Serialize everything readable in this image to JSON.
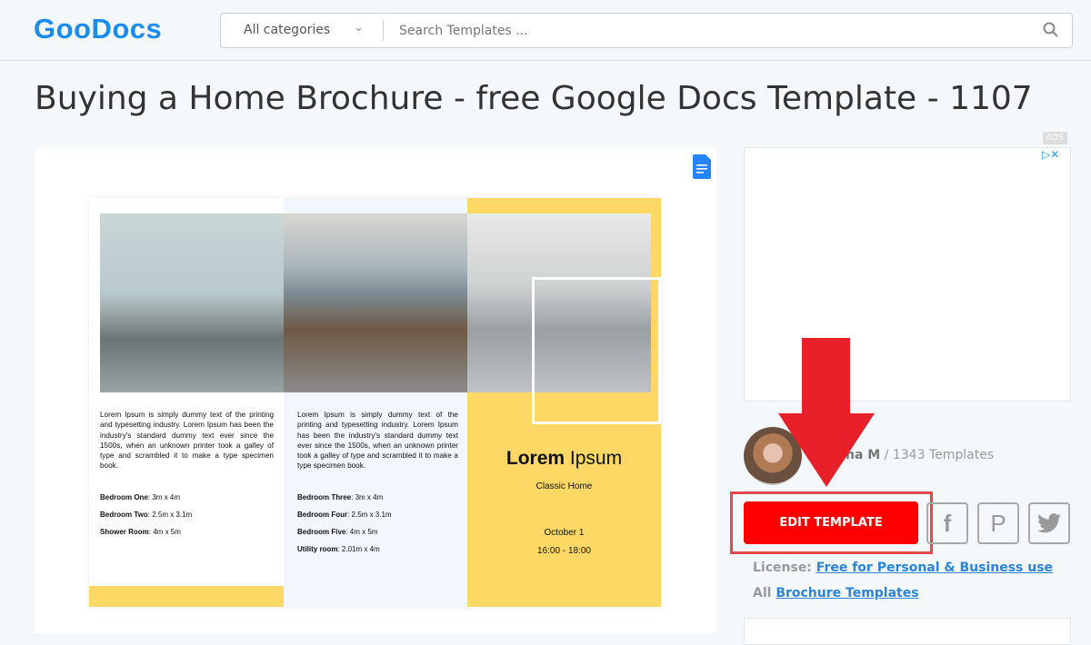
{
  "header": {
    "logo": "GooDocs",
    "category_select": "All categories",
    "search_placeholder": "Search Templates ..."
  },
  "page_title": "Buying a Home Brochure - free Google Docs Template - 1107",
  "brochure": {
    "lorem_left": "Lorem Ipsum is simply dummy text of the printing and typesetting industry. Lorem Ipsum has been the industry's standard dummy text ever since the 1500s, when an unknown printer took a galley of type and scrambled it to make a type specimen book.",
    "lorem_middle": "Lorem Ipsum is simply dummy text of the printing and typesetting industry. Lorem Ipsum has been the industry's standard dummy text ever since the 1500s, when an unknown printer took a galley of type and scrambled it to make a type specimen book.",
    "specs_left": [
      {
        "k": "Bedroom One",
        "v": ": 3m x 4m"
      },
      {
        "k": "Bedroom Two",
        "v": ": 2.5m x 3.1m"
      },
      {
        "k": "Shower Room",
        "v": ": 4m x 5m"
      }
    ],
    "specs_middle": [
      {
        "k": "Bedroom Three",
        "v": ": 3m x 4m"
      },
      {
        "k": "Bedroom Four",
        "v": ": 2.5m x 3.1m"
      },
      {
        "k": "Bedroom Five",
        "v": ": 4m x 5m"
      },
      {
        "k": "Utility room",
        "v": ": 2.01m x 4m"
      }
    ],
    "heading_bold": "Lorem",
    "heading_rest": " Ipsum",
    "subtitle": "Classic Home",
    "date": "October 1",
    "time": "16:00 - 18:00"
  },
  "ads": {
    "label": "ADS"
  },
  "author": {
    "name": "na M",
    "count": " / 1343 Templates"
  },
  "actions": {
    "edit": "EDIT TEMPLATE",
    "facebook": "f",
    "pinterest": "P"
  },
  "license": {
    "label": "License: ",
    "link": "Free for Personal & Business use"
  },
  "all": {
    "label": "All ",
    "link": "Brochure Templates"
  },
  "colors": {
    "brand": "#1a8cf0",
    "edit_button": "#fe0000",
    "brochure_yellow": "#fdd865",
    "arrow": "#e8202a"
  }
}
